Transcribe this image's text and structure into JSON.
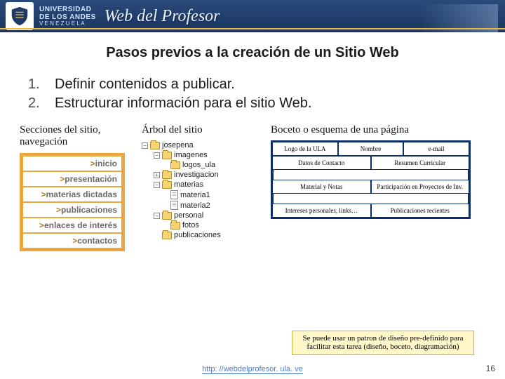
{
  "header": {
    "uni_line1": "UNIVERSIDAD",
    "uni_line2": "DE LOS ANDES",
    "uni_line3": "V E N E Z U E L A",
    "brand": "Web del Profesor"
  },
  "title": "Pasos previos a la creación de un Sitio Web",
  "steps": [
    {
      "num": "1.",
      "text": "Definir contenidos a publicar."
    },
    {
      "num": "2.",
      "text": "Estructurar información para el sitio Web."
    }
  ],
  "columns": {
    "nav_heading": "Secciones del sitio, navegación",
    "tree_heading": "Árbol del sitio",
    "sketch_heading": "Boceto o esquema de una página"
  },
  "nav_items": [
    "inicio",
    "presentación",
    "materias dictadas",
    "publicaciones",
    "enlaces de interés",
    "contactos"
  ],
  "tree": {
    "root": "josepena",
    "children": [
      {
        "label": "imagenes",
        "exp": "-",
        "children": [
          {
            "label": "logos_ula"
          }
        ]
      },
      {
        "label": "investigacion",
        "exp": "+"
      },
      {
        "label": "materias",
        "exp": "-",
        "children": [
          {
            "label": "materia1",
            "type": "page"
          },
          {
            "label": "materia2",
            "type": "page"
          }
        ]
      },
      {
        "label": "personal",
        "exp": "-",
        "children": [
          {
            "label": "fotos"
          }
        ]
      },
      {
        "label": "publicaciones"
      }
    ]
  },
  "sketch": {
    "row1": [
      "Logo de la ULA",
      "Nombre",
      "e-mail"
    ],
    "row2": [
      "Datos de Contacto",
      "Resumen Curricular"
    ],
    "row3": [
      "Material y Notas",
      "Participación en Proyectos de Inv."
    ],
    "row4": [
      "Intereses personales, links…",
      "Publicaciones recientes"
    ]
  },
  "note": "Se puede usar un patron de diseño pre-definido para facilitar esta tarea (diseño, boceto, diagramación)",
  "footer": {
    "url_text": "http: //webdelprofesor. ula. ve",
    "url_href": "http://webdelprofesor.ula.ve",
    "page": "16"
  }
}
